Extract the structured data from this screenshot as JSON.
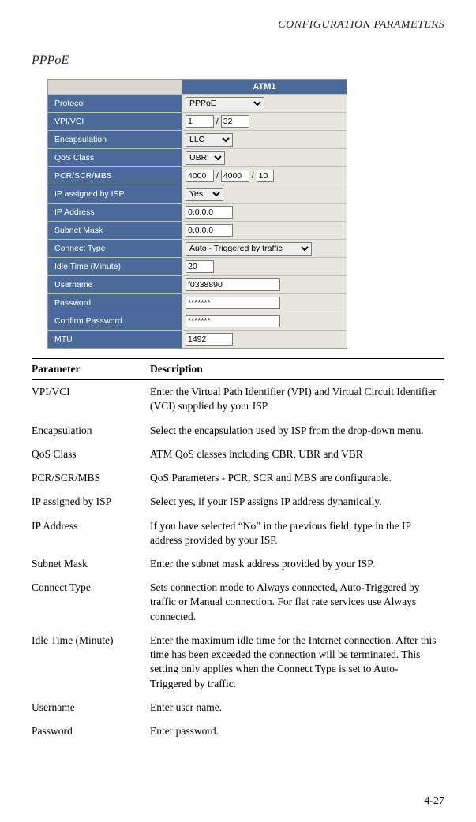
{
  "header": "CONFIGURATION PARAMETERS",
  "section_title": "PPPoE",
  "atm": {
    "title": "ATM1",
    "rows": {
      "protocol": {
        "label": "Protocol",
        "value": "PPPoE"
      },
      "vpi_vci": {
        "label": "VPI/VCI",
        "vpi": "1",
        "vci": "32"
      },
      "encapsulation": {
        "label": "Encapsulation",
        "value": "LLC"
      },
      "qos": {
        "label": "QoS Class",
        "value": "UBR"
      },
      "pcr": {
        "label": "PCR/SCR/MBS",
        "pcr": "4000",
        "scr": "4000",
        "mbs": "10"
      },
      "ip_assigned": {
        "label": "IP assigned by ISP",
        "value": "Yes"
      },
      "ip_address": {
        "label": "IP Address",
        "value": "0.0.0.0"
      },
      "subnet": {
        "label": "Subnet Mask",
        "value": "0.0.0.0"
      },
      "connect_type": {
        "label": "Connect Type",
        "value": "Auto - Triggered by traffic"
      },
      "idle": {
        "label": "Idle Time (Minute)",
        "value": "20"
      },
      "username": {
        "label": "Username",
        "value": "f0338890"
      },
      "password": {
        "label": "Password",
        "value": "*******"
      },
      "confirm": {
        "label": "Confirm Password",
        "value": "*******"
      },
      "mtu": {
        "label": "MTU",
        "value": "1492"
      }
    }
  },
  "table": {
    "headers": {
      "param": "Parameter",
      "desc": "Description"
    },
    "rows": [
      {
        "param": "VPI/VCI",
        "desc": "Enter the Virtual Path Identifier (VPI) and Virtual Circuit Identifier (VCI) supplied by your ISP."
      },
      {
        "param": "Encapsulation",
        "desc": "Select the encapsulation used by ISP from the drop-down menu."
      },
      {
        "param": "QoS Class",
        "desc": "ATM QoS classes including CBR, UBR and VBR"
      },
      {
        "param": "PCR/SCR/MBS",
        "desc": "QoS Parameters - PCR, SCR and MBS are configurable."
      },
      {
        "param": "IP assigned by ISP",
        "desc": "Select yes, if your ISP assigns IP address dynamically."
      },
      {
        "param": "IP Address",
        "desc": "If you have selected “No” in the previous field, type in the IP address provided by your ISP."
      },
      {
        "param": "Subnet Mask",
        "desc": "Enter the subnet mask address provided by your ISP."
      },
      {
        "param": "Connect Type",
        "desc": "Sets connection mode to Always connected, Auto-Triggered by traffic or Manual connection. For flat rate services use Always connected."
      },
      {
        "param": "Idle Time (Minute)",
        "desc": "Enter the maximum idle time for the Internet connection. After this time has been exceeded the connection will be terminated. This setting only applies when the Connect Type is set to Auto-Triggered by traffic."
      },
      {
        "param": "Username",
        "desc": "Enter user name."
      },
      {
        "param": "Password",
        "desc": "Enter password."
      }
    ]
  },
  "page_number": "4-27"
}
